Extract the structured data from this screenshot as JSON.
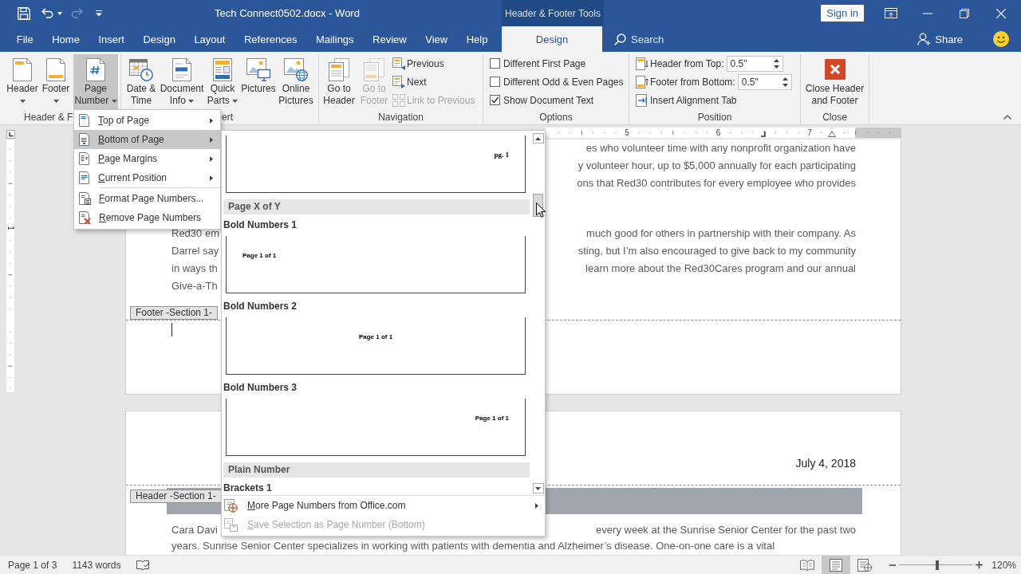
{
  "title_bar": {
    "undo": {
      "disabled": false
    },
    "redo": {
      "disabled": true
    },
    "title": "Tech Connect0502.docx - Word",
    "context_label": "Header & Footer Tools",
    "sign_in": "Sign in"
  },
  "tabs": [
    {
      "label": "File",
      "selected": false
    },
    {
      "label": "Home",
      "selected": false
    },
    {
      "label": "Insert",
      "selected": false
    },
    {
      "label": "Design",
      "selected": false
    },
    {
      "label": "Layout",
      "selected": false
    },
    {
      "label": "References",
      "selected": false
    },
    {
      "label": "Mailings",
      "selected": false
    },
    {
      "label": "Review",
      "selected": false
    },
    {
      "label": "View",
      "selected": false
    },
    {
      "label": "Help",
      "selected": false
    }
  ],
  "context_tabs": [
    {
      "label": "Design",
      "selected": true
    }
  ],
  "search": {
    "placeholder": "Search"
  },
  "share": "Share",
  "ribbon": {
    "groups": [
      {
        "label": "Header & F",
        "buttons": [
          {
            "label": "Header",
            "dropdown": true,
            "pressed": false
          },
          {
            "label": "Footer",
            "dropdown": true,
            "pressed": false
          },
          {
            "label": "Page Number",
            "dropdown": true,
            "pressed": true
          }
        ]
      },
      {
        "label": "ert",
        "buttons": [
          {
            "label": "Date & Time",
            "dropdown": false
          },
          {
            "label": "Document Info",
            "dropdown": true
          },
          {
            "label": "Quick Parts",
            "dropdown": true
          },
          {
            "label": "Pictures",
            "dropdown": false
          },
          {
            "label": "Online Pictures",
            "dropdown": false
          }
        ]
      },
      {
        "label": "Navigation",
        "buttons": [
          {
            "label": "Go to Header",
            "disabled": false
          },
          {
            "label": "Go to Footer",
            "disabled": true
          }
        ],
        "small_buttons": [
          {
            "label": "Previous",
            "disabled": false
          },
          {
            "label": "Next",
            "disabled": false
          },
          {
            "label": "Link to Previous",
            "disabled": true
          }
        ]
      },
      {
        "label": "Options",
        "checkboxes": [
          {
            "label": "Different First Page",
            "checked": false
          },
          {
            "label": "Different Odd & Even Pages",
            "checked": false
          },
          {
            "label": "Show Document Text",
            "checked": true
          }
        ]
      },
      {
        "label": "Position",
        "spinners": [
          {
            "label": "Header from Top:",
            "value": "0.5\""
          },
          {
            "label": "Footer from Bottom:",
            "value": "0.5\""
          }
        ],
        "small_buttons": [
          {
            "label": "Insert Alignment Tab",
            "disabled": false
          }
        ]
      },
      {
        "label": "Close",
        "buttons": [
          {
            "label": "Close Header and Footer"
          }
        ]
      }
    ]
  },
  "page_number_menu": {
    "sections": [
      {
        "items": [
          {
            "label": "Top of Page",
            "submenu": true,
            "selected": false
          },
          {
            "label": "Bottom of Page",
            "submenu": true,
            "selected": true
          },
          {
            "label": "Page Margins",
            "submenu": true,
            "selected": false
          },
          {
            "label": "Current Position",
            "submenu": true,
            "selected": false
          }
        ]
      },
      {
        "items": [
          {
            "label": "Format Page Numbers...",
            "submenu": false,
            "selected": false
          },
          {
            "label": "Remove Page Numbers",
            "submenu": false,
            "selected": false
          }
        ]
      }
    ]
  },
  "bottom_of_page_gallery": {
    "items": [
      {
        "kind": "right",
        "text": "pg. 1"
      },
      {
        "kind": "heading",
        "label": "Page X of Y"
      },
      {
        "kind": "left",
        "label": "Bold Numbers 1",
        "text": "Page 1 of 1"
      },
      {
        "kind": "center",
        "label": "Bold Numbers 2",
        "text": "Page 1 of 1"
      },
      {
        "kind": "right",
        "label": "Bold Numbers 3",
        "text": "Page 1 of 1"
      },
      {
        "kind": "heading",
        "label": "Plain Number"
      },
      {
        "kind": "label",
        "label": "Brackets 1"
      }
    ],
    "commands": [
      {
        "label": "More Page Numbers from Office.com",
        "submenu": true,
        "disabled": false
      },
      {
        "label": "Save Selection as Page Number (Bottom)",
        "submenu": false,
        "disabled": true
      }
    ]
  },
  "document": {
    "ruler_numbers": [
      "5",
      "6",
      "7"
    ],
    "vertical_ruler_numbers": [
      "1"
    ],
    "page_1": {
      "paragraphs": [
        [
          {
            "right": "es who volunteer time with any nonprofit organization have"
          },
          {
            "right": "y volunteer hour, up to $5,000 annually for each participating"
          },
          {
            "right": "ons that Red30 contributes for every employee who provides"
          }
        ],
        [
          {
            "left": "Red30 em",
            "right": "much good for others in partnership with their company. As"
          },
          {
            "left": "Darrel say",
            "right": "sting, but I’m also encouraged to give back to my community"
          },
          {
            "left": "in ways th",
            "right": "learn more about the Red30Cares program and our annual"
          },
          {
            "left": "Give-a-Th"
          }
        ]
      ],
      "footer_tag": "Footer -Section 1-"
    },
    "page_2": {
      "date": "July 4, 2018",
      "header_tag": "Header -Section 1-",
      "lines": [
        {
          "left": "Cara Davi",
          "right": "every week at the Sunrise Senior Center for the past two"
        },
        {
          "text": "years. Sunrise Senior Center specializes in working with patients with dementia and Alzheimer’s disease. One-on-one care is a vital"
        }
      ]
    }
  },
  "status_bar": {
    "page": "Page 1 of 3",
    "words": "1143 words",
    "views": [
      {
        "selected": false
      },
      {
        "selected": true
      },
      {
        "selected": false
      }
    ],
    "zoom": {
      "level": 0.52,
      "reading": "120%"
    }
  }
}
